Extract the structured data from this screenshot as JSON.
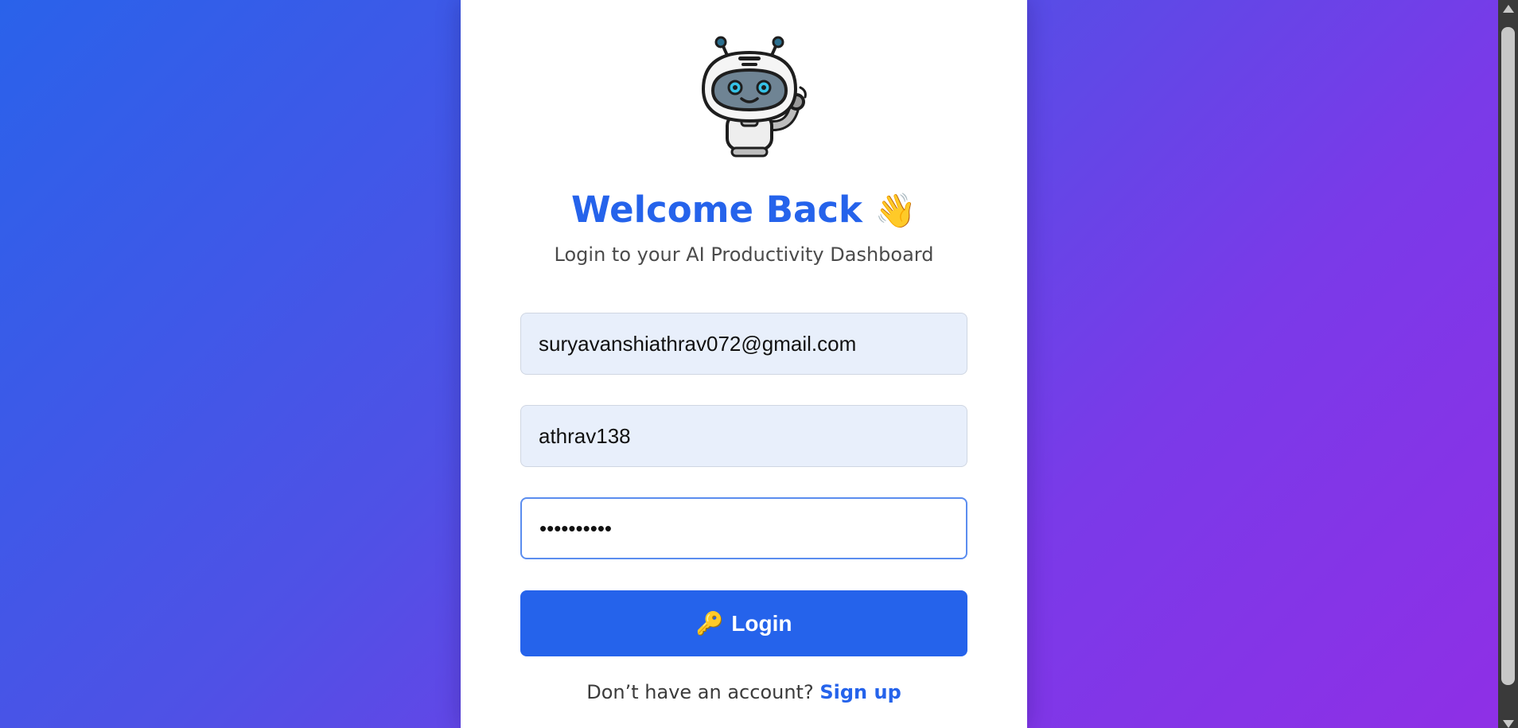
{
  "login": {
    "title": "Welcome Back",
    "wave_emoji": "👋",
    "subtitle": "Login to your AI Productivity Dashboard",
    "email_value": "suryavanshiathrav072@gmail.com",
    "username_value": "athrav138",
    "password_value": "athrav1382",
    "button_icon": "🔑",
    "button_label": "Login",
    "footer_text": "Don’t have an account?",
    "signup_label": "Sign up"
  },
  "icons": {
    "logo": "robot-mascot-icon",
    "wave": "waving-hand-icon",
    "button": "key-icon"
  },
  "colors": {
    "accent": "#2563eb",
    "gradient_start": "#2a62ea",
    "gradient_end": "#8f2fe6",
    "field_fill": "#e8effb",
    "focus_border": "#5b8def"
  }
}
